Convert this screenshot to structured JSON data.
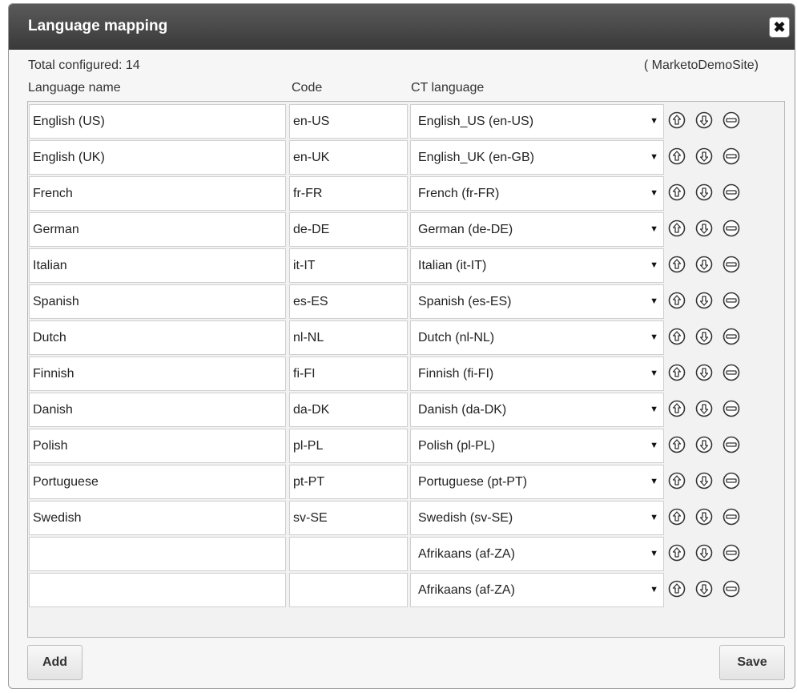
{
  "dialog": {
    "title": "Language mapping",
    "close_label": "✖",
    "total_configured": "Total configured: 14",
    "site_name": "( MarketoDemoSite)"
  },
  "columns": {
    "name": "Language name",
    "code": "Code",
    "ct": "CT language"
  },
  "rows": [
    {
      "name": "English (US)",
      "code": "en-US",
      "ct": "English_US (en-US)"
    },
    {
      "name": "English (UK)",
      "code": "en-UK",
      "ct": "English_UK (en-GB)"
    },
    {
      "name": "French",
      "code": "fr-FR",
      "ct": "French (fr-FR)"
    },
    {
      "name": "German",
      "code": "de-DE",
      "ct": "German (de-DE)"
    },
    {
      "name": "Italian",
      "code": "it-IT",
      "ct": "Italian (it-IT)"
    },
    {
      "name": "Spanish",
      "code": "es-ES",
      "ct": "Spanish (es-ES)"
    },
    {
      "name": "Dutch",
      "code": "nl-NL",
      "ct": "Dutch (nl-NL)"
    },
    {
      "name": "Finnish",
      "code": "fi-FI",
      "ct": "Finnish (fi-FI)"
    },
    {
      "name": "Danish",
      "code": "da-DK",
      "ct": "Danish (da-DK)"
    },
    {
      "name": "Polish",
      "code": "pl-PL",
      "ct": "Polish (pl-PL)"
    },
    {
      "name": "Portuguese",
      "code": "pt-PT",
      "ct": "Portuguese (pt-PT)"
    },
    {
      "name": "Swedish",
      "code": "sv-SE",
      "ct": "Swedish (sv-SE)"
    },
    {
      "name": "",
      "code": "",
      "ct": "Afrikaans (af-ZA)"
    },
    {
      "name": "",
      "code": "",
      "ct": "Afrikaans (af-ZA)"
    }
  ],
  "row_icons": [
    "arrow-up-circle-icon",
    "arrow-down-circle-icon",
    "minus-circle-icon"
  ],
  "buttons": {
    "add": "Add",
    "save": "Save"
  }
}
